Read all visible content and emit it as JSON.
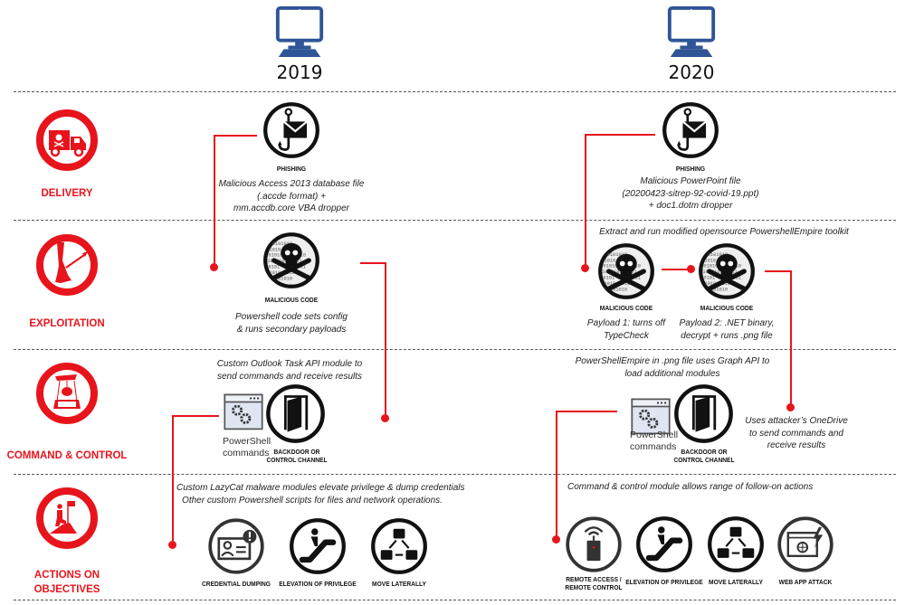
{
  "columns": [
    {
      "year": "2019",
      "icon": "desktop-monitor-icon"
    },
    {
      "year": "2020",
      "icon": "desktop-monitor-icon"
    }
  ],
  "colors": {
    "accent_red": "#e8141c",
    "monitor_blue": "#2f5597",
    "icon_black": "#111111"
  },
  "stages": [
    {
      "label": "DELIVERY",
      "icon": "malware-truck-icon"
    },
    {
      "label": "EXPLOITATION",
      "icon": "arrow-heel-icon"
    },
    {
      "label": "COMMAND & CONTROL",
      "icon": "puppet-control-icon"
    },
    {
      "label_line1": "ACTIONS ON",
      "label_line2": "OBJECTIVES",
      "icon": "flag-summit-icon"
    }
  ],
  "y2019": {
    "delivery": {
      "caption": "PHISHING",
      "desc": [
        "Malicious Access 2013 database file",
        "(.accde format) +",
        "mm.accdb.core VBA dropper"
      ]
    },
    "exploitation": {
      "caption": "MALICIOUS CODE",
      "desc": [
        "Powershell code sets config",
        "& runs secondary payloads"
      ]
    },
    "c2": {
      "desc": [
        "Custom Outlook Task API module to",
        "send commands and receive results"
      ],
      "ps_label": [
        "PowerShell",
        "commands"
      ],
      "caption": [
        "BACKDOOR OR",
        "CONTROL CHANNEL"
      ]
    },
    "actions": {
      "desc": [
        "Custom LazyCat malware modules elevate privilege & dump credentials",
        "Other custom Powershell scripts for files and network operations."
      ],
      "items": [
        "CREDENTIAL DUMPING",
        "ELEVATION OF PRIVILEGE",
        "MOVE LATERALLY"
      ]
    }
  },
  "y2020": {
    "delivery": {
      "caption": "PHISHING",
      "desc": [
        "Malicious PowerPoint file",
        "(20200423-sitrep-92-covid-19.ppt)",
        "+ doc1.dotm dropper"
      ]
    },
    "exploitation": {
      "header": "Extract and run modified opensource PowershellEmpire toolkit",
      "payload1": {
        "caption": "MALICIOUS CODE",
        "desc": [
          "Payload 1: turns off",
          "TypeCheck"
        ]
      },
      "payload2": {
        "caption": "MALICIOUS CODE",
        "desc": [
          "Payload 2: .NET binary,",
          "decrypt + runs .png file"
        ]
      }
    },
    "c2": {
      "desc": [
        "PowerShellEmpire in .png file uses Graph API to",
        "load additional modules"
      ],
      "ps_label": [
        "PowerShell",
        "commands"
      ],
      "caption": [
        "BACKDOOR OR",
        "CONTROL CHANNEL"
      ],
      "side_note": [
        "Uses attacker’s OneDrive",
        "to send commands and",
        "receive results"
      ]
    },
    "actions": {
      "desc": "Command & control module allows range of follow-on actions",
      "items": [
        [
          "REMOTE ACCESS /",
          "REMOTE CONTROL"
        ],
        "ELEVATION OF PRIVILEGE",
        "MOVE LATERALLY",
        "WEB APP ATTACK"
      ]
    }
  }
}
